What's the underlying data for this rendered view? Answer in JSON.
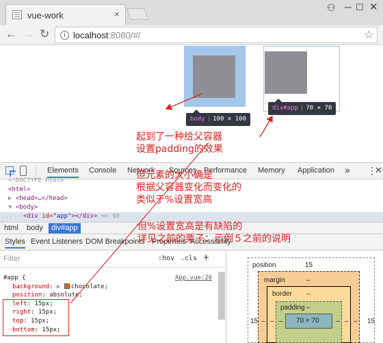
{
  "browser": {
    "tab_title": "vue-work",
    "tab_close": "×",
    "window_user": "⚇",
    "window_minimize": "─",
    "window_maximize": "☐",
    "window_close": "✕",
    "nav_back": "←",
    "nav_forward": "→",
    "nav_reload": "↻",
    "info_icon": "i",
    "url_host": "localhost",
    "url_path": ":8080/#/",
    "bookmark_star": "☆"
  },
  "viewport": {
    "tooltip_body": {
      "selector": "body",
      "size": "100 × 100"
    },
    "tooltip_app": {
      "selector": "div#app",
      "size": "70 × 70"
    }
  },
  "devtools": {
    "tabs": [
      {
        "label": "Elements"
      },
      {
        "label": "Console"
      },
      {
        "label": "Network"
      },
      {
        "label": "Sources"
      },
      {
        "label": "Performance"
      },
      {
        "label": "Memory"
      },
      {
        "label": "Application"
      }
    ],
    "more": "»",
    "kebab": "⋮",
    "close": "✕",
    "elements_tree": {
      "doctype": "<!DOCTYPE html>",
      "html_open": "<html>",
      "head_collapsed": "<head>…</head>",
      "body_open": "<body>",
      "div_tag": "div",
      "div_attr": "id",
      "div_val": "\"app\"",
      "div_close": "</div>",
      "dollar_zero": "== $0",
      "ellipsis": "..."
    },
    "breadcrumbs": [
      "html",
      "body",
      "div#app"
    ],
    "sidebar_tabs": [
      "Styles",
      "Event Listeners",
      "DOM Breakpoints",
      "Properties",
      "Accessibility"
    ],
    "filter_placeholder": "Filter",
    "hov": ":hov",
    "cls": ".cls",
    "add": "+",
    "rule": {
      "selector": "#app {",
      "source": "App.vue:26",
      "declarations": [
        {
          "prop": "background",
          "value": "chocolate;",
          "swatch": "#d2691e"
        },
        {
          "prop": "position",
          "value": "absolute;"
        },
        {
          "prop": "left",
          "value": "15px;"
        },
        {
          "prop": "right",
          "value": "15px;"
        },
        {
          "prop": "top",
          "value": "15px;"
        },
        {
          "prop": "bottom",
          "value": "15px;"
        }
      ]
    },
    "box_model": {
      "position_label": "position",
      "position_value": "15",
      "margin_label": "margin",
      "margin_value": "–",
      "border_label": "border",
      "border_value": "–",
      "padding_label": "padding",
      "padding_value": "–",
      "content_size": "70 × 70",
      "left_value": "15",
      "right_value": "15",
      "dash": "–"
    }
  },
  "annotations": {
    "a1_line1": "起到了一种给父容器",
    "a1_line2": "设置padding的效果",
    "a2_line1": "但元素的大小确是",
    "a2_line2": "根据父容器变化而变化的",
    "a2_line3": "类似于%设置宽高",
    "a3_line1": "但%设置宽高是有缺陷的",
    "a3_line2": "详见之前的栗子：示例５之前的说明",
    "color": "#e02020"
  }
}
